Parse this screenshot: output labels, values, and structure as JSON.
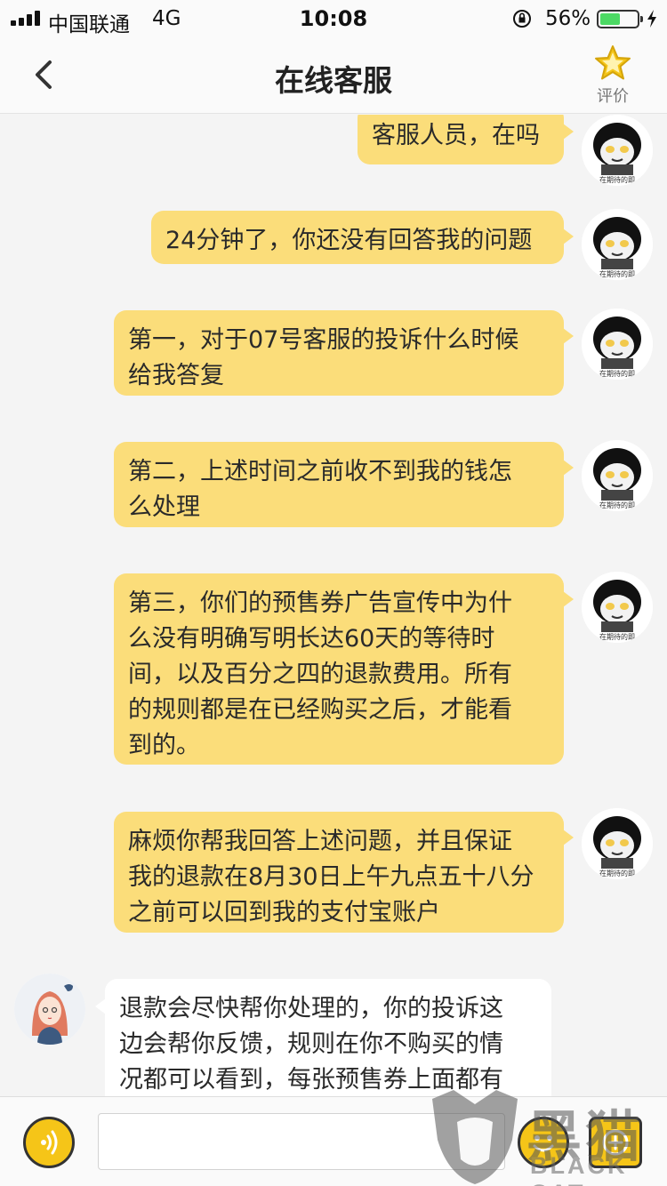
{
  "status_bar": {
    "carrier": "中国联通",
    "network": "4G",
    "time": "10:08",
    "battery_percent": "56%",
    "battery_level": 0.56,
    "icons": [
      "signal-bars-icon",
      "orientation-lock-icon",
      "battery-icon",
      "charging-icon"
    ]
  },
  "nav": {
    "back_icon": "chevron-left-icon",
    "title": "在线客服",
    "rate_icon": "star-icon",
    "rate_label": "评价"
  },
  "messages": [
    {
      "side": "out",
      "text": "客服人员，在吗",
      "avatar_caption": "在期待的即"
    },
    {
      "side": "out",
      "text": "24分钟了，你还没有回答我的问题",
      "avatar_caption": "在期待的即"
    },
    {
      "side": "out",
      "lines": [
        "第一，对于07号客服的投诉什么时候",
        "给我答复"
      ],
      "avatar_caption": "在期待的即"
    },
    {
      "side": "out",
      "lines": [
        "第二，上述时间之前收不到我的钱怎",
        "么处理"
      ],
      "avatar_caption": "在期待的即"
    },
    {
      "side": "out",
      "lines": [
        "第三，你们的预售券广告宣传中为什",
        "么没有明确写明长达60天的等待时",
        "间，以及百分之四的退款费用。所有",
        "的规则都是在已经购买之后，才能看",
        "到的。"
      ],
      "avatar_caption": "在期待的即"
    },
    {
      "side": "out",
      "lines": [
        "麻烦你帮我回答上述问题，并且保证",
        "我的退款在8月30日上午九点五十八分",
        "之前可以回到我的支付宝账户"
      ],
      "avatar_caption": "在期待的即"
    },
    {
      "side": "in",
      "lines": [
        "退款会尽快帮你处理的，你的投诉这",
        "边会帮你反馈，规则在你不购买的情",
        "况都可以看到，每张预售券上面都有"
      ]
    }
  ],
  "input_bar": {
    "voice_icon": "voice-wave-icon",
    "input_value": "",
    "input_placeholder": "",
    "emoji_icon": "smiley-icon",
    "more_icon": "plus-icon"
  },
  "watermark": {
    "text": "黑猫",
    "sub": "BLACK CAT"
  },
  "colors": {
    "bubble_out": "#fbdd7a",
    "bubble_in": "#ffffff",
    "accent": "#f5c518",
    "background": "#f4f4f4"
  }
}
